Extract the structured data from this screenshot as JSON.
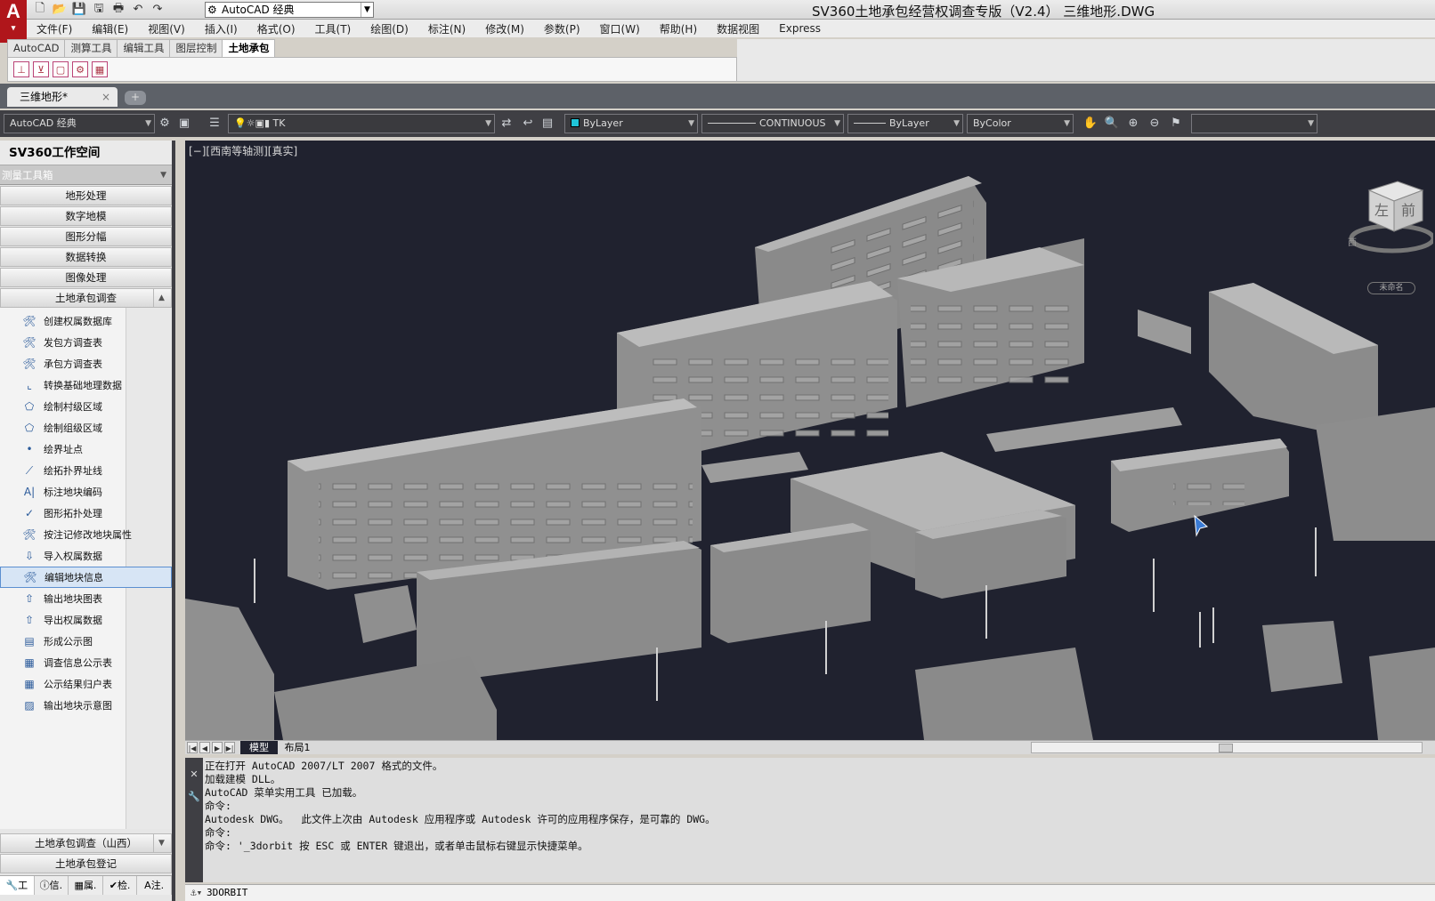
{
  "window": {
    "title": "SV360土地承包经营权调查专版（V2.4）     三维地形.DWG",
    "workspace": "AutoCAD 经典"
  },
  "menu": [
    "文件(F)",
    "编辑(E)",
    "视图(V)",
    "插入(I)",
    "格式(O)",
    "工具(T)",
    "绘图(D)",
    "标注(N)",
    "修改(M)",
    "参数(P)",
    "窗口(W)",
    "帮助(H)",
    "数据视图",
    "Express"
  ],
  "ribbon": {
    "tabs": [
      "AutoCAD",
      "测算工具",
      "编辑工具",
      "图层控制",
      "土地承包"
    ],
    "active_tab": "土地承包"
  },
  "doc_tab": {
    "label": "三维地形*",
    "close": "×",
    "new": "+"
  },
  "property_toolbar": {
    "workspace": "AutoCAD 经典",
    "layer": "TK",
    "color": "ByLayer",
    "linetype": "CONTINUOUS",
    "lineweight": "ByLayer",
    "plotstyle": "ByColor",
    "swatch_color": "#20c4d8"
  },
  "palette": {
    "title": "SV360工作空间",
    "section": "测量工具箱",
    "buttons": [
      "地形处理",
      "数字地模",
      "图形分幅",
      "数据转换",
      "图像处理"
    ],
    "group": "土地承包调查",
    "tools": [
      {
        "label": "创建权属数据库",
        "icon": "database-wrench-icon"
      },
      {
        "label": "发包方调查表",
        "icon": "form-wrench-icon"
      },
      {
        "label": "承包方调查表",
        "icon": "form-wrench-icon"
      },
      {
        "label": "转换基础地理数据",
        "icon": "convert-axis-icon"
      },
      {
        "label": "绘制村级区域",
        "icon": "polygon-icon"
      },
      {
        "label": "绘制组级区域",
        "icon": "polygon-icon"
      },
      {
        "label": "绘界址点",
        "icon": "dot-icon"
      },
      {
        "label": "绘拓扑界址线",
        "icon": "line-icon"
      },
      {
        "label": "标注地块编码",
        "icon": "text-label-icon"
      },
      {
        "label": "图形拓扑处理",
        "icon": "spellcheck-icon"
      },
      {
        "label": "按注记修改地块属性",
        "icon": "attribute-wrench-icon"
      },
      {
        "label": "导入权属数据",
        "icon": "import-icon"
      },
      {
        "label": "编辑地块信息",
        "icon": "edit-wrench-icon"
      },
      {
        "label": "输出地块图表",
        "icon": "export-icon"
      },
      {
        "label": "导出权属数据",
        "icon": "export-icon"
      },
      {
        "label": "形成公示图",
        "icon": "map-sheet-icon"
      },
      {
        "label": "调查信息公示表",
        "icon": "table-icon"
      },
      {
        "label": "公示结果归户表",
        "icon": "table-icon"
      },
      {
        "label": "输出地块示意图",
        "icon": "sketch-icon"
      }
    ],
    "selected_tool": "编辑地块信息",
    "bottom_group": "土地承包调查（山西）",
    "bottom_button": "土地承包登记",
    "tabs": [
      "工",
      "信.",
      "属.",
      "检.",
      "注."
    ]
  },
  "viewport": {
    "label": "[−][西南等轴测][真实]",
    "background": "#20222f",
    "viewcube": {
      "face_left": "左",
      "face_front": "前",
      "compass": "西",
      "name": "未命名"
    }
  },
  "layout_tabs": {
    "model": "模型",
    "layout1": "布局1"
  },
  "command": {
    "history": [
      "正在打开 AutoCAD 2007/LT 2007 格式的文件。",
      "加载建模 DLL。",
      "AutoCAD 菜单实用工具 已加载。",
      "命令:",
      "Autodesk DWG。  此文件上次由 Autodesk 应用程序或 Autodesk 许可的应用程序保存，是可靠的 DWG。",
      "命令:",
      "命令: '_3dorbit 按 ESC 或 ENTER 键退出，或者单击鼠标右键显示快捷菜单。"
    ],
    "input": "3DORBIT"
  }
}
